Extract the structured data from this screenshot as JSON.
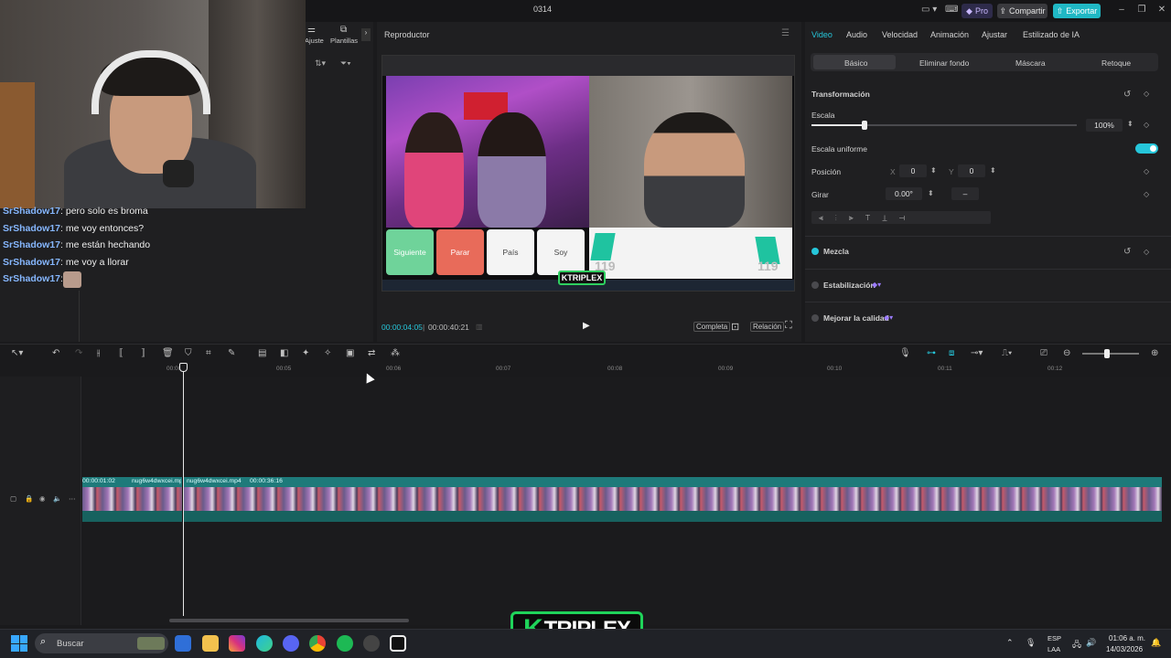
{
  "titlebar": {
    "project": "0314",
    "pro": "Pro",
    "share": "Compartir",
    "export": "Exportar"
  },
  "media_tabs": {
    "adjust": "Ajuste",
    "templates": "Plantillas"
  },
  "chat": [
    {
      "user": "SrShadow17",
      "text": ": pero solo es broma"
    },
    {
      "user": "SrShadow17",
      "text": ": me voy entonces?"
    },
    {
      "user": "SrShadow17",
      "text": ": me están hechando"
    },
    {
      "user": "SrShadow17",
      "text": ": me voy a llorar"
    },
    {
      "user": "SrShadow17",
      "text": ":"
    }
  ],
  "player": {
    "title": "Reproductor",
    "time_current": "00:00:04:05",
    "time_total": "00:00:40:21",
    "full_label": "Completa",
    "ratio_label": "Relación",
    "video": {
      "buttons": [
        "Siguiente",
        "Parar",
        "País",
        "Soy"
      ],
      "score_left": "119",
      "score_right": "119",
      "brand": "KTRIPLEX"
    }
  },
  "inspector": {
    "tabs": [
      "Video",
      "Audio",
      "Velocidad",
      "Animación",
      "Ajustar",
      "Estilizado de IA"
    ],
    "active_tab": "Video",
    "subtabs": [
      "Básico",
      "Eliminar fondo",
      "Máscara",
      "Retoque"
    ],
    "transform": "Transformación",
    "scale_label": "Escala",
    "scale_value": "100%",
    "scale_fraction": 0.2,
    "uniform_label": "Escala uniforme",
    "position_label": "Posición",
    "pos_x_label": "X",
    "pos_x": "0",
    "pos_y_label": "Y",
    "pos_y": "0",
    "rotate_label": "Girar",
    "rotate_value": "0.00°",
    "blend_label": "Mezcla",
    "stabilize_label": "Estabilización",
    "enhance_label": "Mejorar la calidad"
  },
  "timeline": {
    "ticks": [
      "00:00",
      "00:05",
      "00:06",
      "00:07",
      "00:08",
      "00:09",
      "00:10",
      "00:11",
      "00:12"
    ],
    "clip1_time": "00:00:01:02",
    "clip1_name": "nug6w4dwxcei.mp4",
    "clip2_name": "nug6w4dwxcei.mp4",
    "clip2_time": "00:00:36:16"
  },
  "taskbar": {
    "search": "Buscar",
    "lang1": "ESP",
    "lang2": "LAA",
    "time": "01:06 a. m.",
    "date": "14/03/2026"
  },
  "brand_overlay": "TRIPLEX",
  "brand_letter": "K",
  "colors": {
    "accent": "#26c6da",
    "clip": "#1e7a7a",
    "brand_green": "#1fd35a"
  }
}
